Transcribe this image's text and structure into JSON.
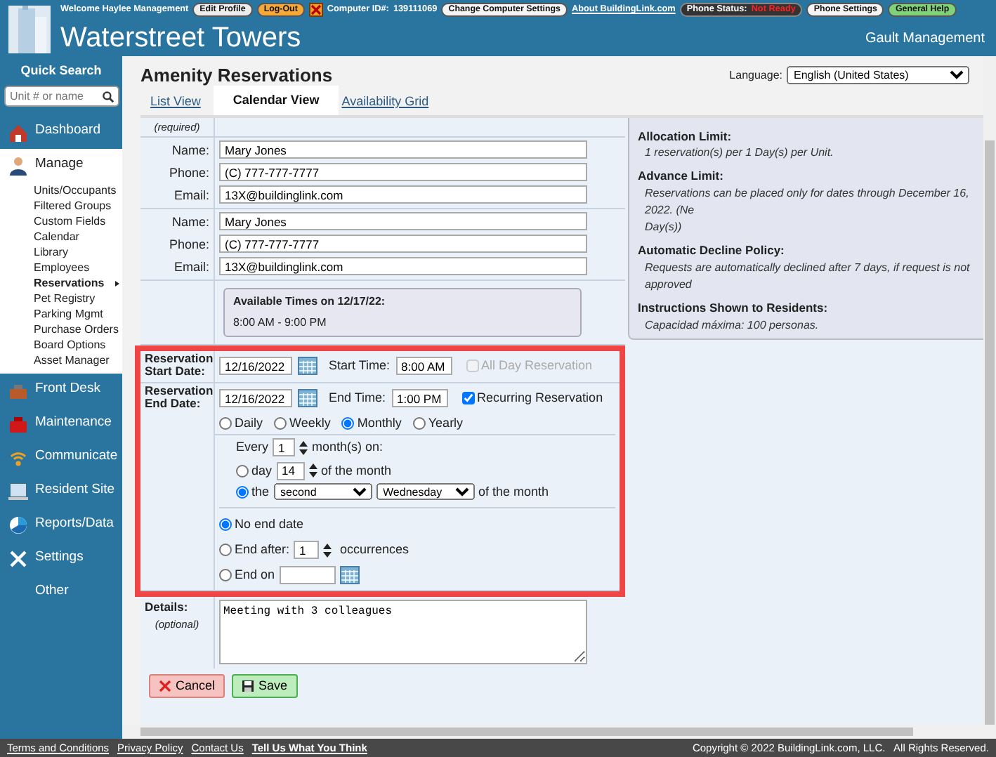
{
  "topbar": [
    {
      "kind": "text",
      "label": "Welcome  Haylee Management"
    },
    {
      "kind": "button",
      "label": "Edit Profile",
      "color": "#ececec"
    },
    {
      "kind": "button",
      "label": "Log-Out",
      "color": "#f5a83a"
    },
    {
      "kind": "status",
      "label": "Computer ID#:",
      "value": "139111069"
    },
    {
      "kind": "button",
      "label": "Change Computer Settings",
      "color": "#f4f4f4"
    },
    {
      "kind": "link",
      "label": "About BuildingLink.com"
    },
    {
      "kind": "phone",
      "label": "Phone Status:",
      "value": "Not Ready"
    },
    {
      "kind": "button",
      "label": "Phone Settings",
      "color": "#f4f4f4"
    },
    {
      "kind": "button",
      "label": "General Help",
      "color": "#7fd27a"
    }
  ],
  "site": {
    "title": "Waterstreet Towers",
    "company": "Gault Management"
  },
  "sidebar": {
    "search_title": "Quick Search",
    "search_placeholder": "Unit # or name",
    "sections": [
      {
        "label": "Dashboard",
        "expanded": false
      },
      {
        "label": "Manage",
        "expanded": true,
        "children": [
          {
            "label": "Units/Occupants",
            "selected": false
          },
          {
            "label": "Filtered Groups",
            "selected": false
          },
          {
            "label": "Custom Fields",
            "selected": false
          },
          {
            "label": "Calendar",
            "selected": false
          },
          {
            "label": "Library",
            "selected": false
          },
          {
            "label": "Employees",
            "selected": false
          },
          {
            "label": "Reservations",
            "selected": true
          },
          {
            "label": "Pet Registry",
            "selected": false
          },
          {
            "label": "Parking Mgmt",
            "selected": false
          },
          {
            "label": "Purchase Orders",
            "selected": false
          },
          {
            "label": "Board Options",
            "selected": false
          },
          {
            "label": "Asset Manager",
            "selected": false
          }
        ]
      },
      {
        "label": "Front Desk",
        "expanded": false
      },
      {
        "label": "Maintenance",
        "expanded": false
      },
      {
        "label": "Communicate",
        "expanded": false
      },
      {
        "label": "Resident Site",
        "expanded": false
      },
      {
        "label": "Reports/Data",
        "expanded": false
      },
      {
        "label": "Settings",
        "expanded": false
      },
      {
        "label": "Other",
        "expanded": false
      }
    ]
  },
  "main": {
    "title": "Amenity Reservations",
    "language_label": "Language:",
    "language": "English (United States)",
    "tabs": [
      {
        "label": "List View",
        "selected": false
      },
      {
        "label": "Calendar View",
        "selected": true
      },
      {
        "label": "Availability Grid",
        "selected": false
      }
    ]
  },
  "form": {
    "required_note": "(required)",
    "contacts": [
      {
        "fields": [
          {
            "label": "Name:",
            "value": "Mary Jones"
          },
          {
            "label": "Phone:",
            "value": "(C) 777-777-7777"
          },
          {
            "label": "Email:",
            "value": "13X@buildinglink.com"
          }
        ]
      },
      {
        "fields": [
          {
            "label": "Name:",
            "value": "Mary Jones"
          },
          {
            "label": "Phone:",
            "value": "(C) 777-777-7777"
          },
          {
            "label": "Email:",
            "value": "13X@buildinglink.com"
          }
        ]
      }
    ],
    "available": {
      "title": "Available Times on 12/17/22:",
      "times": "8:00 AM - 9:00 PM"
    },
    "start": {
      "label": "Reservation Start Date:",
      "date": "12/16/2022",
      "time_label": "Start Time:",
      "time": "8:00 AM",
      "option": {
        "label": "All Day Reservation",
        "checked": false,
        "disabled": true
      }
    },
    "end": {
      "label": "Reservation End Date:",
      "date": "12/16/2022",
      "time_label": "End Time:",
      "time": "1:00 PM",
      "option": {
        "label": "Recurring Reservation",
        "checked": true,
        "disabled": false
      }
    },
    "frequency": [
      {
        "label": "Daily",
        "selected": false
      },
      {
        "label": "Weekly",
        "selected": false
      },
      {
        "label": "Monthly",
        "selected": true
      },
      {
        "label": "Yearly",
        "selected": false
      }
    ],
    "every": {
      "prefix": "Every",
      "value": "1",
      "suffix": "month(s) on:"
    },
    "monthly": [
      {
        "kind": "day",
        "selected": false,
        "prefix": "day",
        "value": "14",
        "suffix": "of the month"
      },
      {
        "kind": "ordinal",
        "selected": true,
        "prefix": "the",
        "ordinal": "second",
        "weekday": "Wednesday",
        "suffix": "of the month"
      }
    ],
    "ending": [
      {
        "kind": "none",
        "selected": true,
        "label": "No end date"
      },
      {
        "kind": "after",
        "selected": false,
        "label": "End after:",
        "value": "1",
        "suffix": "occurrences"
      },
      {
        "kind": "date",
        "selected": false,
        "label": "End on"
      }
    ],
    "details": {
      "label": "Details:",
      "note": "(optional)",
      "value": "Meeting with 3 colleagues"
    },
    "buttons": [
      {
        "kind": "cancel",
        "label": "Cancel"
      },
      {
        "kind": "save",
        "label": "Save"
      }
    ]
  },
  "info": [
    {
      "title": "Allocation Limit:",
      "lines": [
        "1 reservation(s) per 1 Day(s) per Unit."
      ]
    },
    {
      "title": "Advance Limit:",
      "lines": [
        "Reservations can be placed only for dates through December 16, 2022. (Ne",
        "Day(s))"
      ]
    },
    {
      "title": "Automatic Decline Policy:",
      "lines": [
        "Requests are automatically declined after 7 days, if request is not approved"
      ]
    },
    {
      "title": "Instructions Shown to Residents:",
      "lines": [
        "Capacidad máxima: 100 personas."
      ]
    }
  ],
  "footer": {
    "links": [
      {
        "label": "Terms and Conditions",
        "bold": false
      },
      {
        "label": "Privacy Policy",
        "bold": false
      },
      {
        "label": "Contact Us",
        "bold": false
      },
      {
        "label": "Tell Us What You Think",
        "bold": true
      }
    ],
    "copyright": "Copyright © 2022 BuildingLink.com, LLC.   All Rights Reserved."
  }
}
